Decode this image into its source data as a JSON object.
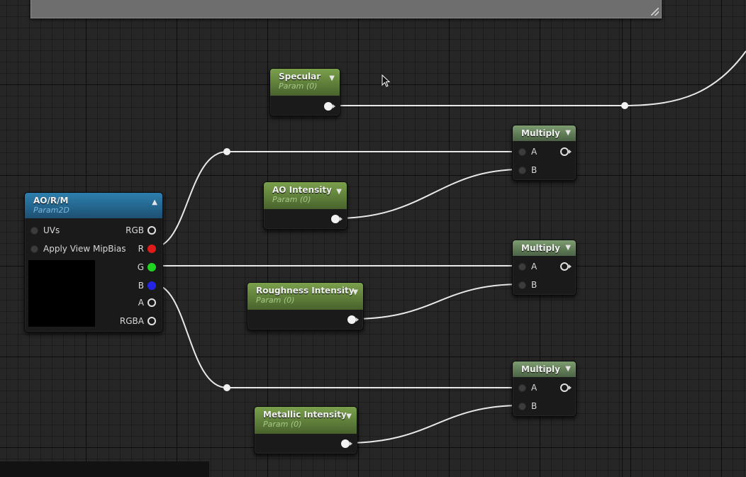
{
  "nodes": {
    "specular": {
      "title": "Specular",
      "subtitle": "Param (0)"
    },
    "ao_intensity": {
      "title": "AO Intensity",
      "subtitle": "Param (0)"
    },
    "roughness_intensity": {
      "title": "Roughness Intensity",
      "subtitle": "Param (0)"
    },
    "metallic_intensity": {
      "title": "Metallic Intensity",
      "subtitle": "Param (0)"
    },
    "multiply_1": {
      "title": "Multiply",
      "pin_a": "A",
      "pin_b": "B"
    },
    "multiply_2": {
      "title": "Multiply",
      "pin_a": "A",
      "pin_b": "B"
    },
    "multiply_3": {
      "title": "Multiply",
      "pin_a": "A",
      "pin_b": "B"
    },
    "texture": {
      "title": "AO/R/M",
      "subtitle": "Param2D",
      "inputs": [
        "UVs",
        "Apply View MipBias"
      ],
      "outputs": [
        "RGB",
        "R",
        "G",
        "B",
        "A",
        "RGBA"
      ]
    }
  },
  "colors": {
    "pin_r": "#e01b1b",
    "pin_g": "#21d321",
    "pin_b": "#2424e6",
    "wire": "#e8e8e8",
    "param_header": "#5f7f3a",
    "texture_header": "#24668f"
  },
  "icons": {
    "collapse": "chevron-down-icon",
    "expand": "chevron-up-icon",
    "cursor": "mouse-pointer-icon"
  }
}
